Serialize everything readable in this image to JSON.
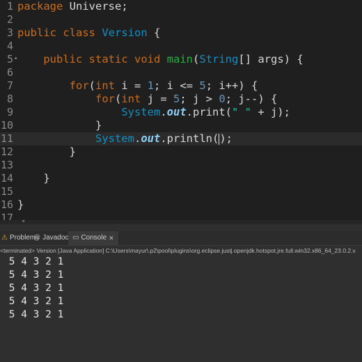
{
  "editor": {
    "line_numbers": [
      "1",
      "2",
      "3",
      "4",
      "5",
      "6",
      "7",
      "8",
      "9",
      "10",
      "11",
      "12",
      "13",
      "14",
      "15",
      "16",
      "17"
    ],
    "override_marker": "•",
    "lines": [
      {
        "tokens": [
          {
            "c": "kw",
            "t": "package"
          },
          {
            "c": "plain",
            "t": " Universe;"
          }
        ]
      },
      {
        "tokens": []
      },
      {
        "tokens": [
          {
            "c": "kw",
            "t": "public"
          },
          {
            "c": "plain",
            "t": " "
          },
          {
            "c": "kw",
            "t": "class"
          },
          {
            "c": "plain",
            "t": " "
          },
          {
            "c": "ty",
            "t": "Version"
          },
          {
            "c": "plain",
            "t": " {"
          }
        ]
      },
      {
        "tokens": []
      },
      {
        "tokens": [
          {
            "c": "plain",
            "t": "    "
          },
          {
            "c": "kw",
            "t": "public"
          },
          {
            "c": "plain",
            "t": " "
          },
          {
            "c": "kw",
            "t": "static"
          },
          {
            "c": "plain",
            "t": " "
          },
          {
            "c": "kw",
            "t": "void"
          },
          {
            "c": "plain",
            "t": " "
          },
          {
            "c": "fn",
            "t": "main"
          },
          {
            "c": "plain",
            "t": "("
          },
          {
            "c": "ty",
            "t": "String"
          },
          {
            "c": "plain",
            "t": "[] "
          },
          {
            "c": "plain",
            "t": "args"
          },
          {
            "c": "plain",
            "t": ") {"
          }
        ]
      },
      {
        "tokens": []
      },
      {
        "tokens": [
          {
            "c": "plain",
            "t": "        "
          },
          {
            "c": "kw",
            "t": "for"
          },
          {
            "c": "plain",
            "t": "("
          },
          {
            "c": "kw",
            "t": "int"
          },
          {
            "c": "plain",
            "t": " i = "
          },
          {
            "c": "num",
            "t": "1"
          },
          {
            "c": "plain",
            "t": "; i <= "
          },
          {
            "c": "num",
            "t": "5"
          },
          {
            "c": "plain",
            "t": "; i++) {"
          }
        ]
      },
      {
        "tokens": [
          {
            "c": "plain",
            "t": "            "
          },
          {
            "c": "kw",
            "t": "for"
          },
          {
            "c": "plain",
            "t": "("
          },
          {
            "c": "kw",
            "t": "int"
          },
          {
            "c": "plain",
            "t": " j = "
          },
          {
            "c": "num",
            "t": "5"
          },
          {
            "c": "plain",
            "t": "; j > "
          },
          {
            "c": "num",
            "t": "0"
          },
          {
            "c": "plain",
            "t": "; j--) {"
          }
        ]
      },
      {
        "tokens": [
          {
            "c": "plain",
            "t": "                "
          },
          {
            "c": "stat",
            "t": "System"
          },
          {
            "c": "plain",
            "t": "."
          },
          {
            "c": "fld",
            "t": "out"
          },
          {
            "c": "plain",
            "t": ".print("
          },
          {
            "c": "str",
            "t": "\" \""
          },
          {
            "c": "plain",
            "t": " + j);"
          }
        ]
      },
      {
        "tokens": [
          {
            "c": "plain",
            "t": "            }"
          }
        ]
      },
      {
        "tokens": [
          {
            "c": "plain",
            "t": "            "
          },
          {
            "c": "stat",
            "t": "System"
          },
          {
            "c": "plain",
            "t": "."
          },
          {
            "c": "fld",
            "t": "out"
          },
          {
            "c": "plain",
            "t": ".println("
          },
          {
            "c": "caret",
            "t": ""
          },
          {
            "c": "plain",
            "t": ");"
          }
        ]
      },
      {
        "tokens": [
          {
            "c": "plain",
            "t": "        }"
          }
        ]
      },
      {
        "tokens": []
      },
      {
        "tokens": [
          {
            "c": "plain",
            "t": "    }"
          }
        ]
      },
      {
        "tokens": []
      },
      {
        "tokens": [
          {
            "c": "plain",
            "t": "}"
          }
        ]
      },
      {
        "tokens": []
      }
    ],
    "current_line_index": 10
  },
  "views_bar": {
    "tabs": [
      {
        "label": "Problems",
        "icon": "problems-icon",
        "glyph": "⚠"
      },
      {
        "label": "Javadoc",
        "icon": "javadoc-icon",
        "glyph": "@"
      },
      {
        "label": "Console",
        "icon": "console-icon",
        "glyph": "▭",
        "active": true,
        "close": "✕"
      }
    ]
  },
  "console": {
    "title": "<terminated> Version [Java Application] C:\\Users\\mayur\\.p2\\pool\\plugins\\org.eclipse.justj.openjdk.hotspot.jre.full.win32.x86_64_23.0.2.v",
    "output": [
      " 5 4 3 2 1",
      " 5 4 3 2 1",
      " 5 4 3 2 1",
      " 5 4 3 2 1",
      " 5 4 3 2 1"
    ]
  }
}
